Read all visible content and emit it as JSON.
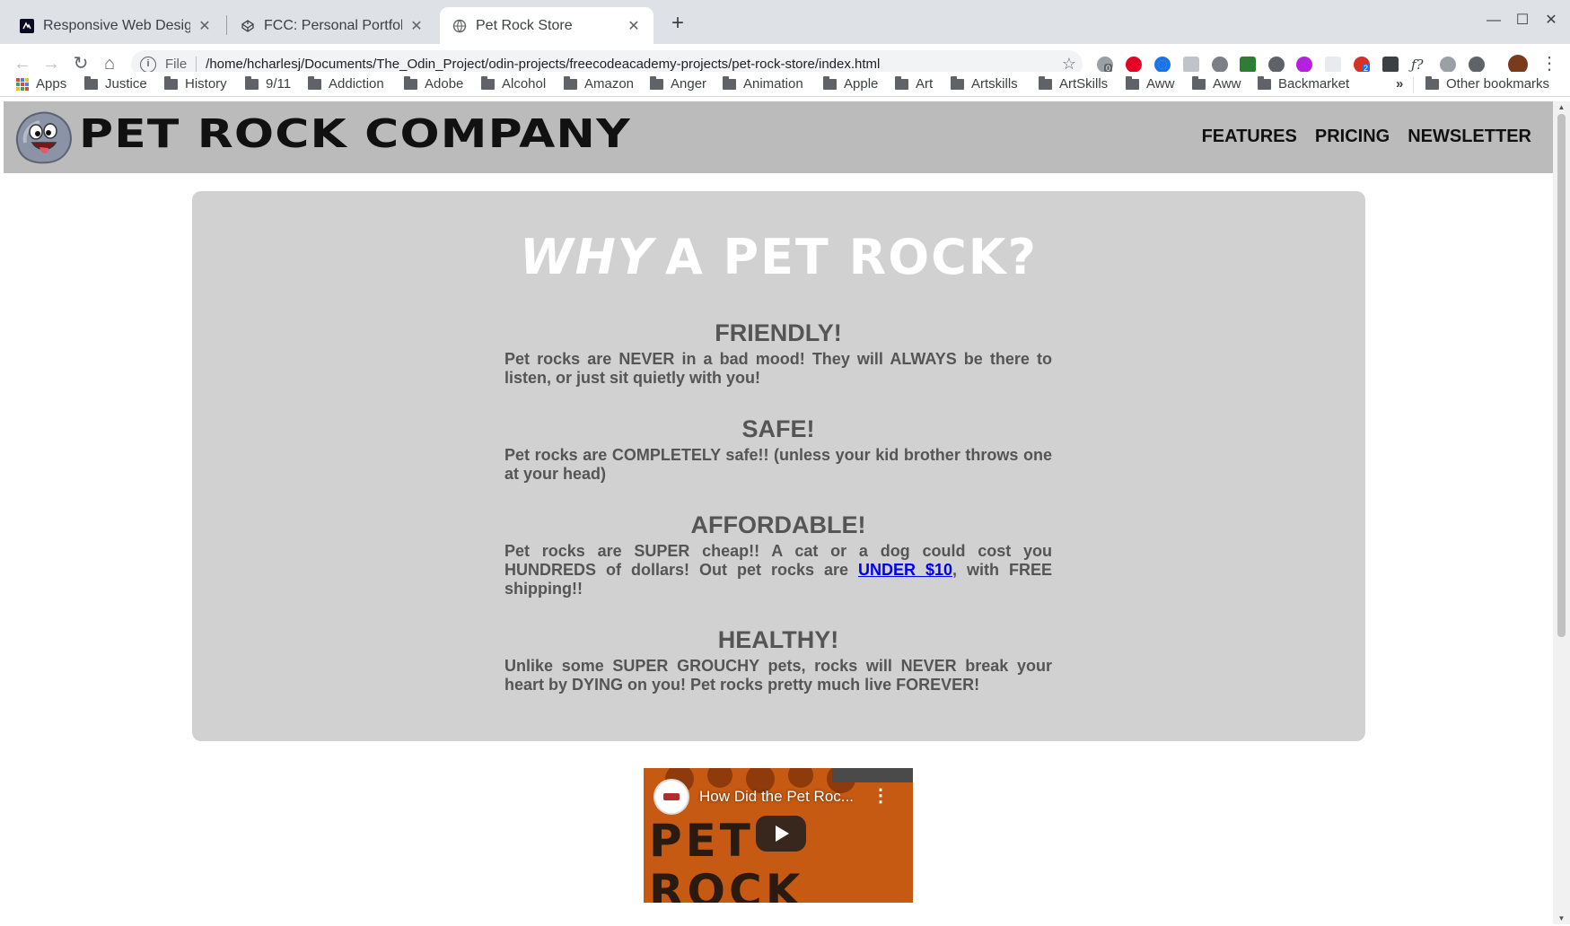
{
  "browser": {
    "tabs": [
      {
        "title": "Responsive Web Design P",
        "icon": "freecodecamp-icon"
      },
      {
        "title": "FCC: Personal Portfolio",
        "icon": "codepen-icon"
      },
      {
        "title": "Pet Rock Store",
        "icon": "globe-icon",
        "active": true
      }
    ],
    "new_tab_label": "+",
    "address": {
      "scheme_label": "File",
      "url": "/home/hcharlesj/Documents/The_Odin_Project/odin-projects/freecodeacademy-projects/pet-rock-store/index.html"
    },
    "extension_badges": [
      "0",
      "2"
    ],
    "bookmarks": [
      "Apps",
      "Justice",
      "History",
      "9/11",
      "Addiction",
      "Adobe",
      "Alcohol",
      "Amazon",
      "Anger",
      "Animation",
      "Apple",
      "Art",
      "Artskills",
      "ArtSkills",
      "Aww",
      "Aww",
      "Backmarket"
    ],
    "bookmarks_overflow": "»",
    "other_bookmarks": "Other bookmarks"
  },
  "site": {
    "brand": "PET ROCK COMPANY",
    "nav": [
      "FEATURES",
      "PRICING",
      "NEWSLETTER"
    ],
    "hero": {
      "emphasis": "WHY",
      "rest": "A PET ROCK?"
    },
    "features": [
      {
        "title": "FRIENDLY!",
        "text": "Pet rocks are NEVER in a bad mood! They will ALWAYS be there to listen, or just sit quietly with you!"
      },
      {
        "title": "SAFE!",
        "text": "Pet rocks are COMPLETELY safe!! (unless your kid brother throws one at your head)"
      },
      {
        "title": "AFFORDABLE!",
        "text_before": "Pet rocks are SUPER cheap!! A cat or a dog could cost you HUNDREDS of dollars! Out pet rocks are ",
        "link": "UNDER $10",
        "text_after": ", with FREE shipping!!"
      },
      {
        "title": "HEALTHY!",
        "text": "Unlike some SUPER GROUCHY pets, rocks will NEVER break your heart by DYING on you! Pet rocks pretty much live FOREVER!"
      }
    ],
    "video": {
      "title": "How Did the Pet Roc...",
      "thumbnail_text": [
        "PET",
        "ROCK"
      ],
      "menu_icon": "more-vert-icon",
      "play_icon": "play-icon"
    }
  },
  "colors": {
    "header_bg": "#bbbbbb",
    "card_bg": "#d1d1d1",
    "feature_text": "#555555",
    "link": "#0000ee",
    "hero_text": "#ffffff"
  }
}
